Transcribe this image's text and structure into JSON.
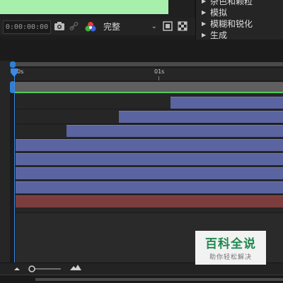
{
  "viewer": {
    "timecode": "0:00:00:00",
    "resolution": "完整",
    "icons": [
      "camera-icon",
      "link-icon",
      "rgb-icon",
      "chevron-down-icon",
      "roi-icon",
      "transparency-icon"
    ]
  },
  "effects_panel": {
    "items": [
      {
        "label": "杂色和颗粒"
      },
      {
        "label": "模拟"
      },
      {
        "label": "模糊和锐化"
      },
      {
        "label": "生成"
      }
    ]
  },
  "timeline": {
    "ruler_labels": [
      "0s",
      "01s"
    ],
    "colors": {
      "playhead": "#3a8ae8",
      "work_area_end": "#58c95c",
      "layer_bar": "#5a64a0",
      "layer_bar_red": "#7b3d3d"
    },
    "icons": [
      "zoom-out-icon",
      "zoom-slider",
      "zoom-in-icon"
    ]
  },
  "watermark": {
    "title": "百科全说",
    "subtitle": "助你轻松解决"
  }
}
